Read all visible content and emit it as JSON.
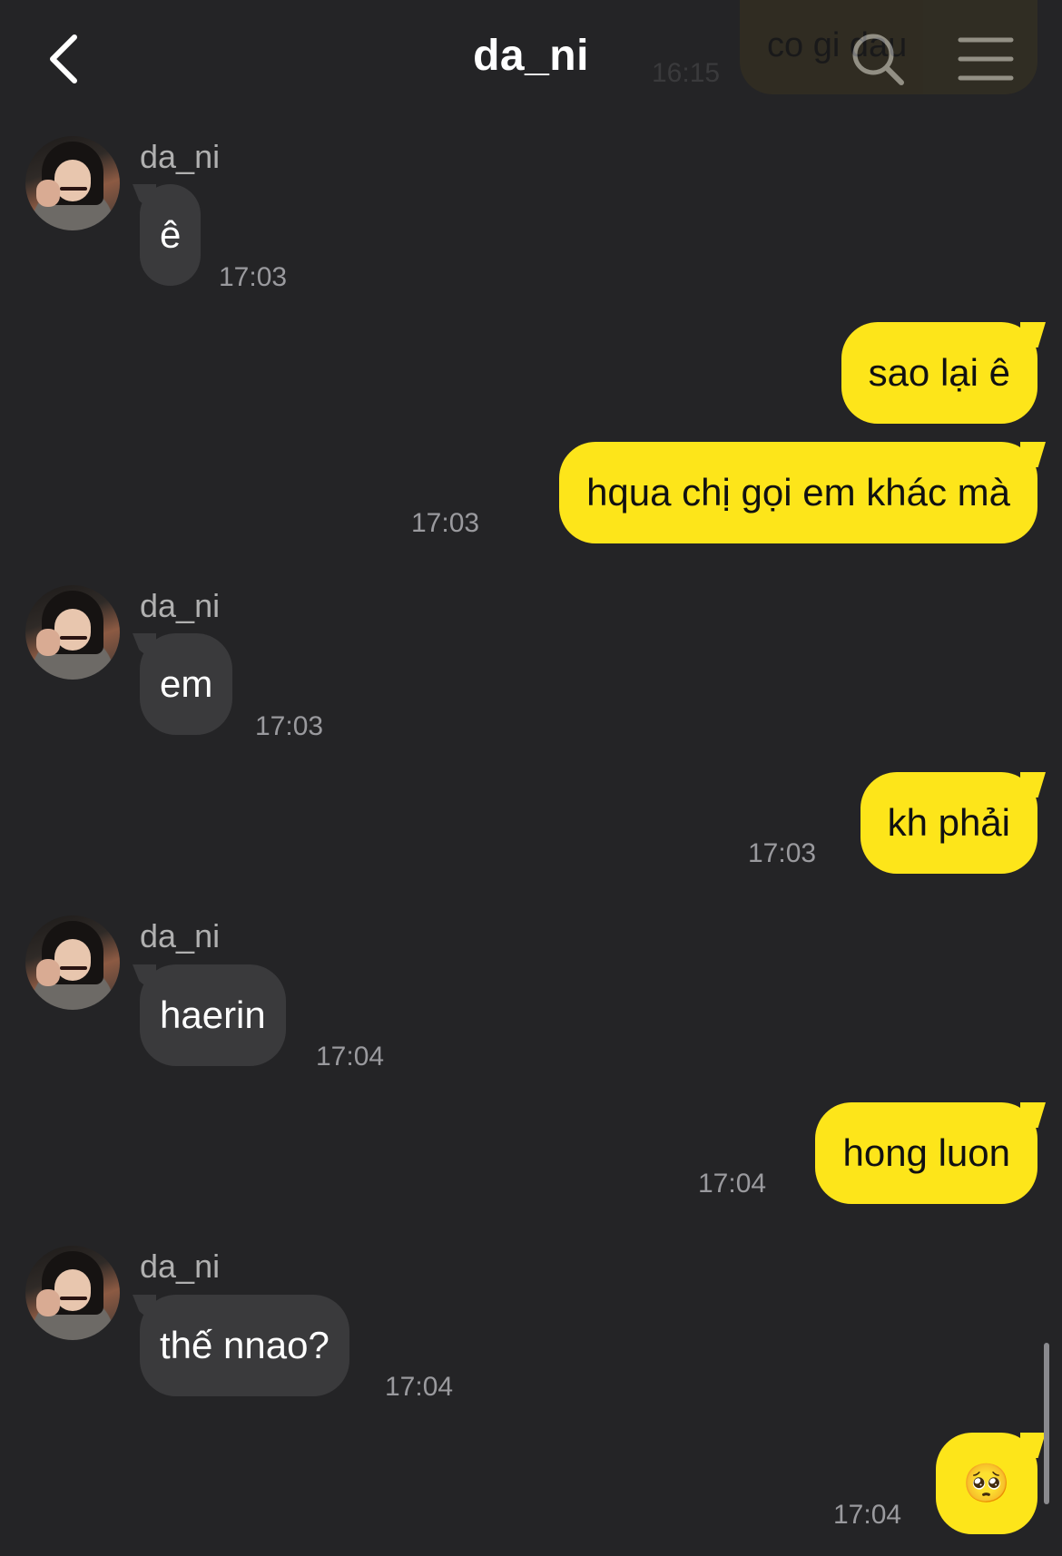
{
  "header": {
    "title": "da_ni",
    "back_icon": "chevron-left-icon",
    "search_icon": "search-icon",
    "menu_icon": "hamburger-menu-icon"
  },
  "peek": {
    "text": "co gi dau",
    "time": "16:15"
  },
  "messages": [
    {
      "direction": "in",
      "sender": "da_ni",
      "text": "ê",
      "time": "17:03"
    },
    {
      "direction": "out",
      "text": "sao lại ê",
      "time": ""
    },
    {
      "direction": "out",
      "text": "hqua chị gọi em khác mà",
      "time": "17:03"
    },
    {
      "direction": "in",
      "sender": "da_ni",
      "text": "em",
      "time": "17:03"
    },
    {
      "direction": "out",
      "text": "kh phải",
      "time": "17:03"
    },
    {
      "direction": "in",
      "sender": "da_ni",
      "text": "haerin",
      "time": "17:04"
    },
    {
      "direction": "out",
      "text": "hong luon",
      "time": "17:04"
    },
    {
      "direction": "in",
      "sender": "da_ni",
      "text": "thế nnao?",
      "time": "17:04"
    },
    {
      "direction": "out",
      "text": "🥺",
      "time": "17:04"
    }
  ],
  "colors": {
    "background": "#242426",
    "incoming_bubble": "#3a3a3c",
    "outgoing_bubble": "#fde51a",
    "timestamp": "#9a9a9e"
  }
}
